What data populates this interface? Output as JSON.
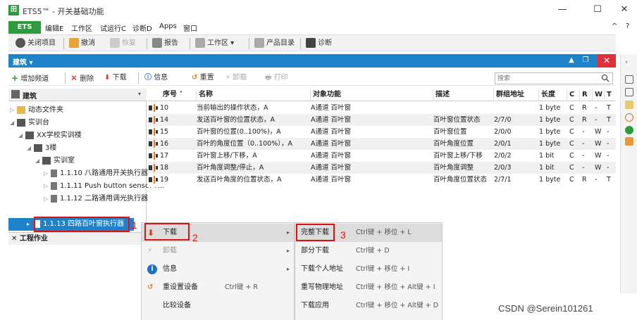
{
  "window": {
    "logo_text": "ETS",
    "title": "ETS5™ - 开关基础功能",
    "minimize": "—",
    "maximize": "☐",
    "close": "✕",
    "collapse": "^",
    "help": "?"
  },
  "menubar": {
    "ets": "ETS",
    "items": [
      "编辑E",
      "工作区",
      "试运行C",
      "诊断D",
      "Apps",
      "窗口"
    ]
  },
  "toolbar": {
    "close_project": "关闭项目",
    "undo": "撤消",
    "redo": "恢复",
    "report": "报告",
    "workspace": "工作区 ▾",
    "catalog": "产品目录",
    "diagnostics": "诊断"
  },
  "panel": {
    "title": "建筑 ▾",
    "close": "✕"
  },
  "toolbar2": {
    "add_channel": "增加频道",
    "delete": "删除",
    "download": "下载",
    "info": "信息",
    "reset": "重置",
    "unload": "卸载",
    "print": "打印",
    "search_placeholder": "搜索"
  },
  "tree": {
    "header": "建筑",
    "items": [
      "动态文件夹",
      "实训台",
      "XX学校实训楼",
      "3楼",
      "实训室",
      "1.1.10 八路通用开关执行器",
      "1.1.11 Push button sensor P...",
      "1.1.12 二路通用调光执行器",
      "1.1.13 四路百叶窗执行器"
    ],
    "work_area": "工程作业"
  },
  "table": {
    "columns": [
      "序号 ˄",
      "名称",
      "对象功能",
      "描述",
      "群组地址",
      "长度",
      "C",
      "R",
      "W",
      "T"
    ],
    "rows": [
      [
        "10",
        "当前输出的操作状态，A",
        "A通道 百叶窗",
        "",
        "",
        "1 byte",
        "C",
        "R",
        "-",
        "T"
      ],
      [
        "14",
        "发送百叶窗的位置状态，A",
        "A通道 百叶窗",
        "百叶窗位置状态",
        "2/7/0",
        "1 byte",
        "C",
        "R",
        "-",
        "T"
      ],
      [
        "15",
        "百叶窗的位置(0..100%)，A",
        "A通道 百叶窗",
        "百叶窗位置",
        "2/0/0",
        "1 byte",
        "C",
        "-",
        "W",
        "-"
      ],
      [
        "16",
        "百叶的角度位置（0..100%），A",
        "A通道 百叶窗",
        "百叶角度位置",
        "2/0/1",
        "1 byte",
        "C",
        "-",
        "W",
        "-"
      ],
      [
        "17",
        "百叶窗上移/下移，A",
        "A通道 百叶窗",
        "百叶窗上移/下移",
        "2/0/2",
        "1 bit",
        "C",
        "-",
        "W",
        "-"
      ],
      [
        "18",
        "百叶角度调整/停止，A",
        "A通道 百叶窗",
        "百叶角度调整",
        "2/0/3",
        "1 bit",
        "C",
        "-",
        "W",
        "-"
      ],
      [
        "19",
        "发送百叶角度的位置状态，A",
        "A通道 百叶窗",
        "百叶角度位置状态",
        "2/7/1",
        "1 byte",
        "C",
        "R",
        "-",
        "T"
      ]
    ]
  },
  "context_menu": {
    "items": [
      {
        "label": "下载",
        "shortcut": "",
        "submenu": "▸"
      },
      {
        "label": "卸载",
        "shortcut": "",
        "submenu": "▸"
      },
      {
        "label": "信息",
        "shortcut": "",
        "submenu": "▸"
      },
      {
        "label": "重设置设备",
        "shortcut": "Ctrl键 + R",
        "submenu": ""
      },
      {
        "label": "比较设备",
        "shortcut": "",
        "submenu": ""
      }
    ]
  },
  "submenu": {
    "items": [
      {
        "label": "完整下载",
        "shortcut": "Ctrl键 + 移位 + L"
      },
      {
        "label": "部分下载",
        "shortcut": "Ctrl键 + D"
      },
      {
        "label": "下载个人地址",
        "shortcut": "Ctrl键 + 移位 + I"
      },
      {
        "label": "重写物理地址",
        "shortcut": "Ctrl键 + 移位 + Alt键 + I"
      },
      {
        "label": "下载应用",
        "shortcut": "Ctrl键 + 移位 + Alt键 + D"
      }
    ]
  },
  "annotations": {
    "step1": "1",
    "step2": "2",
    "step3": "3"
  },
  "watermark": "CSDN @Serein101261",
  "colors": {
    "accent": "#1e82c8",
    "brand": "#2e9a3e",
    "highlight": "#e01010"
  }
}
